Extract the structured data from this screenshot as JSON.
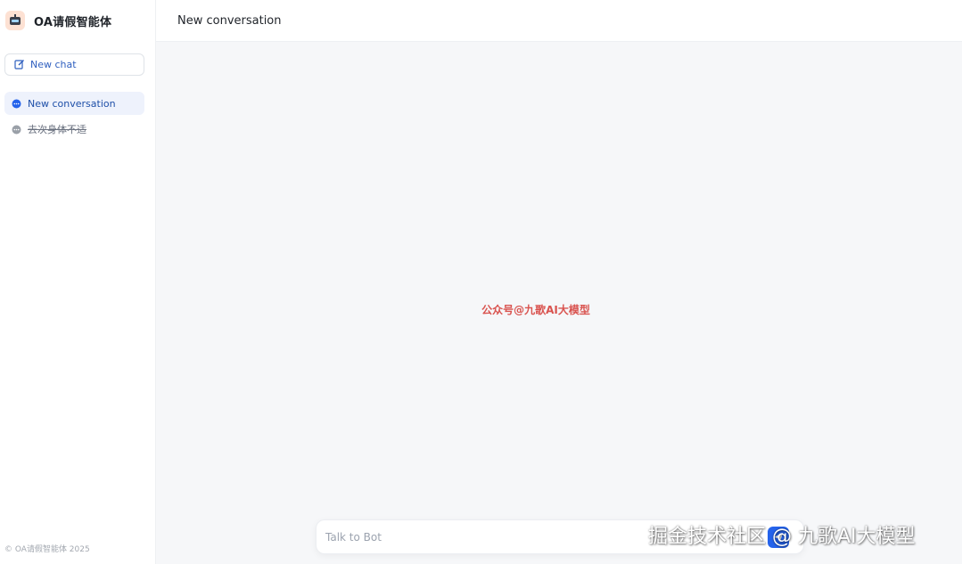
{
  "app": {
    "title": "OA请假智能体"
  },
  "sidebar": {
    "new_chat_label": "New chat",
    "conversations": [
      {
        "label": "New conversation",
        "active": true
      },
      {
        "label": "去次身体不适",
        "active": false
      }
    ],
    "footer": "© OA请假智能体 2025"
  },
  "header": {
    "title": "New conversation"
  },
  "main": {
    "center_text": "公众号@九歌AI大模型"
  },
  "input": {
    "placeholder": "Talk to Bot"
  },
  "watermark": "掘金技术社区 @ 九歌AI大模型",
  "colors": {
    "accent": "#2563eb",
    "active_bg": "#eef2fc",
    "watermark_red": "#d9534f"
  }
}
